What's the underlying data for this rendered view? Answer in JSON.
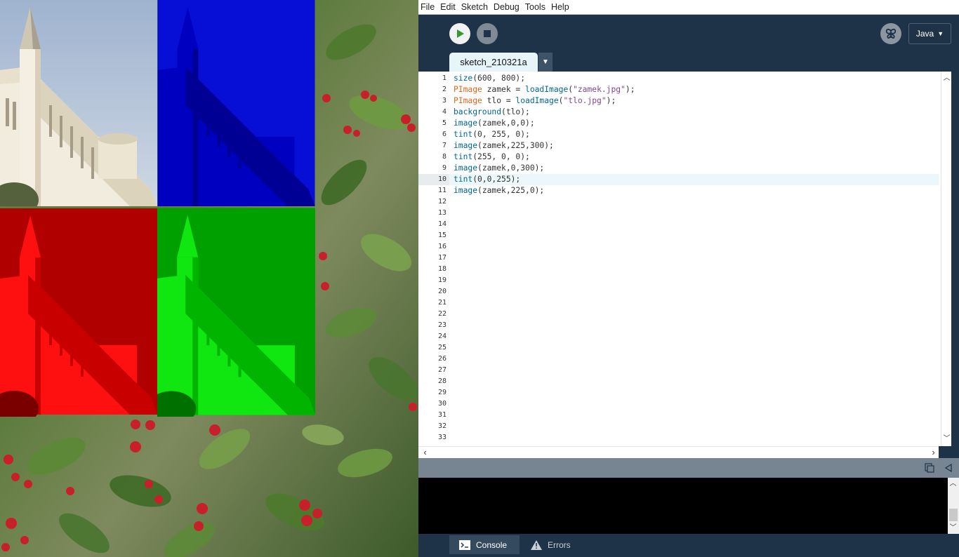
{
  "menubar": {
    "items": [
      "File",
      "Edit",
      "Sketch",
      "Debug",
      "Tools",
      "Help"
    ]
  },
  "toolbar": {
    "run_icon": "play-icon",
    "stop_icon": "stop-icon",
    "debug_icon": "butterfly-icon",
    "mode": "Java",
    "mode_caret": "▼"
  },
  "tabs": {
    "active": "sketch_210321a",
    "menu_caret": "▼"
  },
  "editor": {
    "current_line": 10,
    "line_numbers": [
      "1",
      "2",
      "3",
      "4",
      "5",
      "6",
      "7",
      "8",
      "9",
      "10",
      "11",
      "12",
      "13",
      "14",
      "15",
      "16",
      "17",
      "18",
      "19",
      "20",
      "21",
      "22",
      "23",
      "24",
      "25",
      "26",
      "27",
      "28",
      "29",
      "30",
      "31",
      "32",
      "33"
    ],
    "code": [
      "size(600, 800);",
      "PImage zamek = loadImage(\"zamek.jpg\");",
      "PImage tlo = loadImage(\"tlo.jpg\");",
      "background(tlo);",
      "image(zamek,0,0);",
      "tint(0, 255, 0);",
      "image(zamek,225,300);",
      "tint(255, 0, 0);",
      "image(zamek,0,300);",
      "tint(0,0,255);",
      "image(zamek,225,0);"
    ]
  },
  "console": {
    "tabs": {
      "console_label": "Console",
      "errors_label": "Errors"
    },
    "output": ""
  },
  "colors": {
    "ide_background": "#1e3347",
    "keyword_function": "#006699",
    "keyword_type": "#e2661a",
    "string_literal": "#7d4793",
    "tint_red": "#ff0000",
    "tint_green": "#00ff00",
    "tint_blue": "#0000ff"
  }
}
